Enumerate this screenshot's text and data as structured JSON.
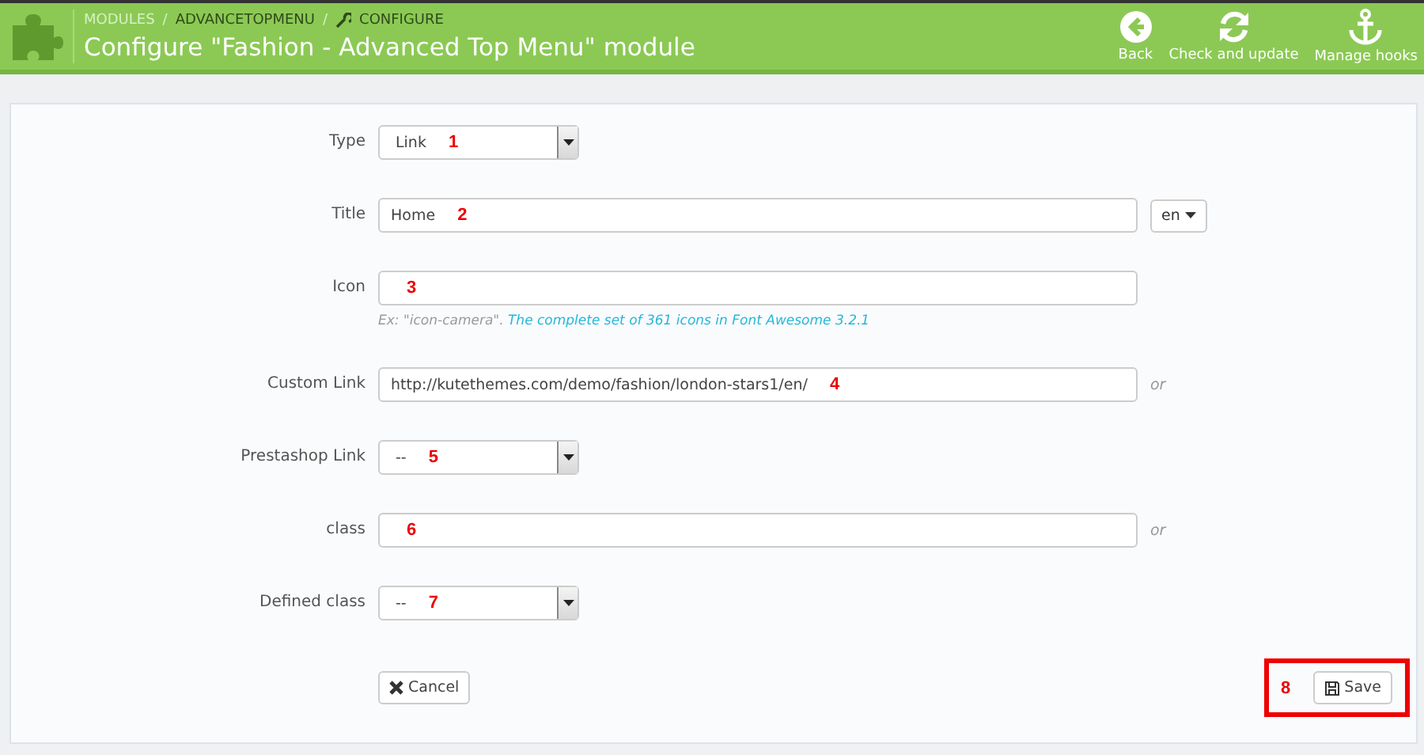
{
  "header": {
    "separator": "/",
    "breadcrumb": [
      {
        "label": "MODULES",
        "kind": "link"
      },
      {
        "label": "ADVANCETOPMENU",
        "kind": "link"
      },
      {
        "label": "CONFIGURE",
        "kind": "current"
      }
    ],
    "title": "Configure \"Fashion - Advanced Top Menu\" module",
    "actions": [
      {
        "label": "Back",
        "kind": "back"
      },
      {
        "label": "Check and update",
        "kind": "refresh"
      },
      {
        "label": "Manage hooks",
        "kind": "anchor"
      }
    ]
  },
  "fields": [
    {
      "label": "Type",
      "kind": "select",
      "value": "Link",
      "marker": "1"
    },
    {
      "label": "Title",
      "kind": "text",
      "value": "Home",
      "marker": "2",
      "lang": "en"
    },
    {
      "label": "Icon",
      "kind": "text",
      "marker": "3",
      "help": "Ex: \"icon-camera\".",
      "help_link": "The complete set of 361 icons in Font Awesome 3.2.1"
    },
    {
      "label": "Custom Link",
      "kind": "text",
      "value": "http://kutethemes.com/demo/fashion/london-stars1/en/",
      "marker": "4",
      "suffix": "or"
    },
    {
      "label": "Prestashop Link",
      "kind": "select",
      "value": "--",
      "marker": "5"
    },
    {
      "label": "class",
      "kind": "text",
      "marker": "6",
      "suffix": "or"
    },
    {
      "label": "Defined class",
      "kind": "select",
      "value": "--",
      "marker": "7"
    }
  ],
  "cancel": "Cancel",
  "save": {
    "label": "Save",
    "marker": "8"
  }
}
